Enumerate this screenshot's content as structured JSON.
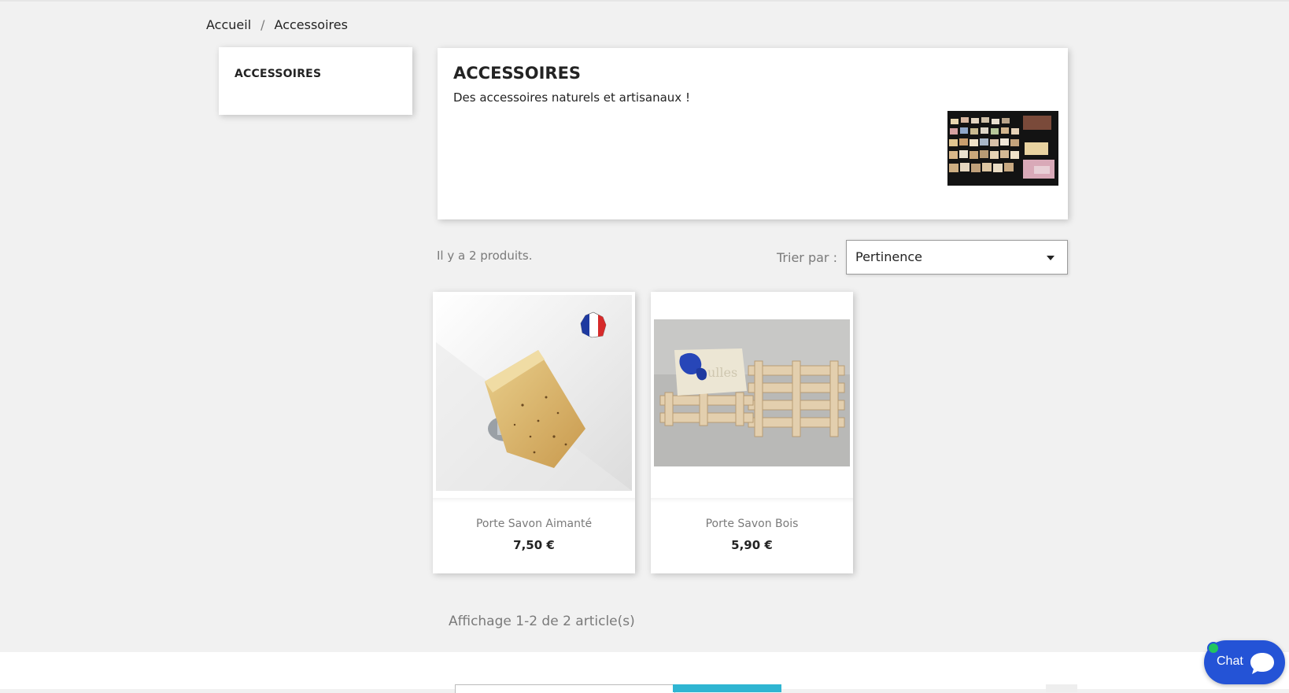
{
  "breadcrumb": {
    "items": [
      "Accueil",
      "Accessoires"
    ],
    "separator": "/"
  },
  "sidebar": {
    "title": "ACCESSOIRES"
  },
  "category": {
    "title": "ACCESSOIRES",
    "description": "Des accessoires naturels et artisanaux !"
  },
  "listing": {
    "count_text": "Il y a 2 produits.",
    "sort_label": "Trier par :",
    "sort_value": "Pertinence",
    "pagination_text": "Affichage 1-2 de 2 article(s)"
  },
  "products": [
    {
      "name": "Porte Savon Aimanté",
      "price": "7,50 €",
      "badge_icon": "france-flag-icon"
    },
    {
      "name": "Porte Savon Bois",
      "price": "5,90 €"
    }
  ],
  "chat": {
    "label": "Chat",
    "status_color": "#22c55e",
    "color": "#2453d6"
  },
  "colors": {
    "accent": "#2fb5d2",
    "background": "#f1f1f1"
  }
}
